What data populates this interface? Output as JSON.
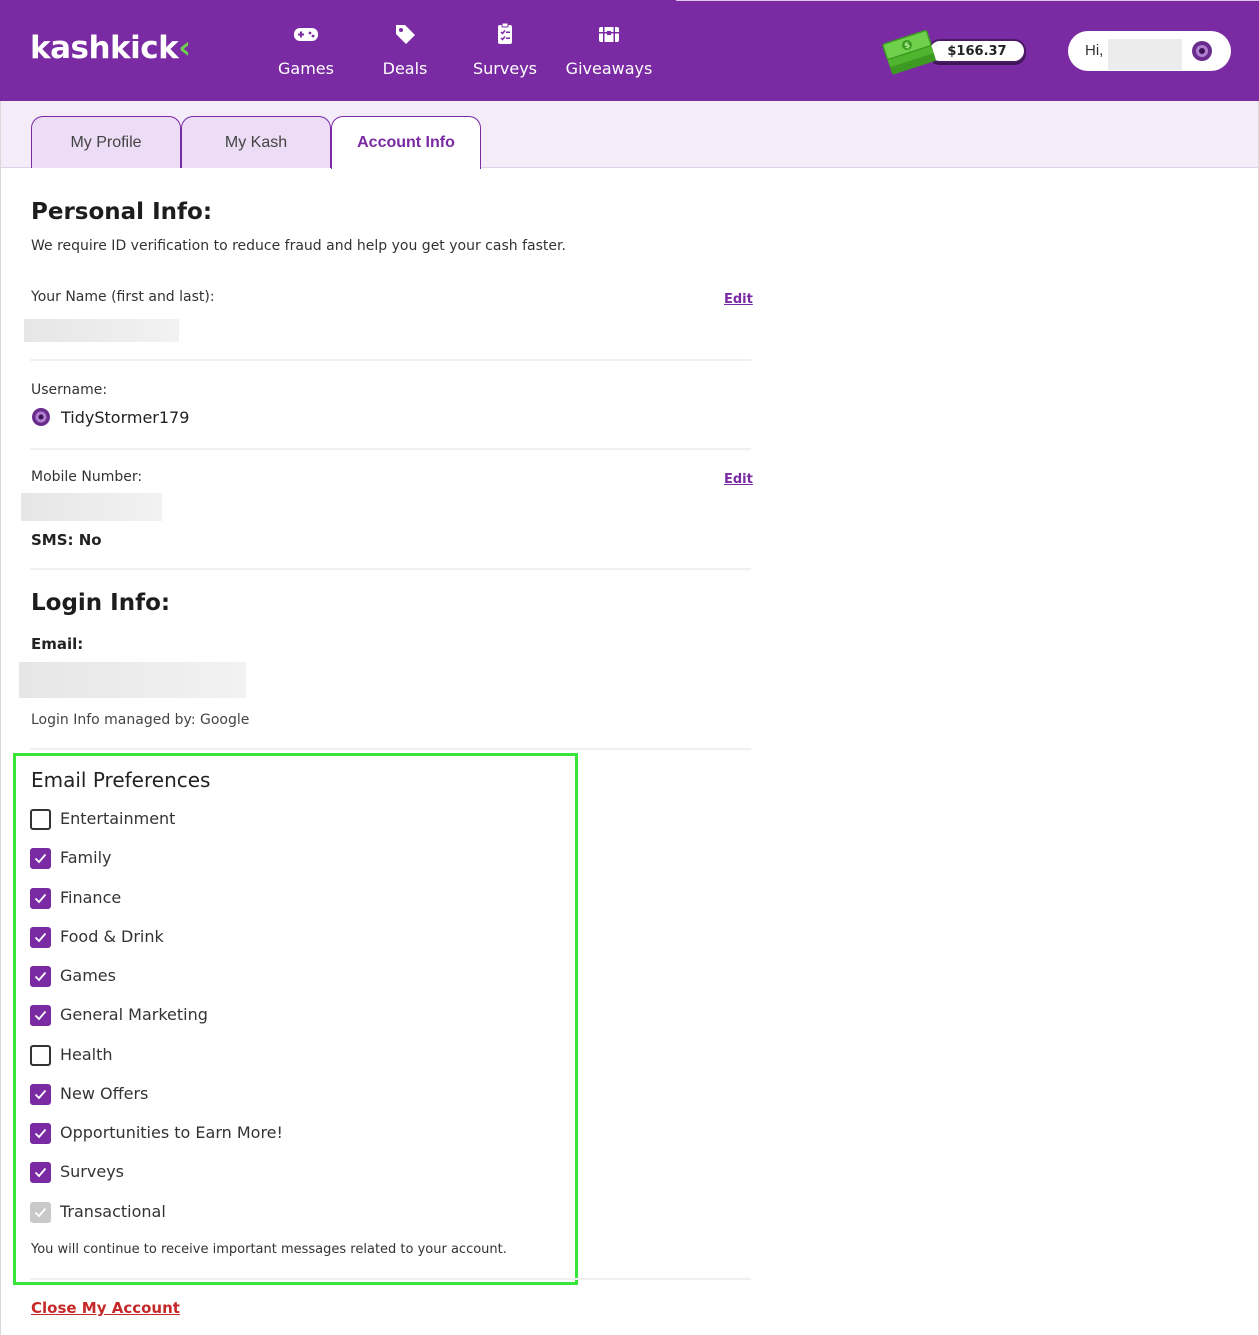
{
  "header": {
    "logo": "kashkick",
    "logo_mark": "‹",
    "nav": [
      {
        "label": "Games",
        "icon": "gamepad-icon"
      },
      {
        "label": "Deals",
        "icon": "tag-icon"
      },
      {
        "label": "Surveys",
        "icon": "clipboard-icon"
      },
      {
        "label": "Giveaways",
        "icon": "treasure-chest-icon"
      }
    ],
    "balance": "$166.37",
    "greeting": "Hi,"
  },
  "tabs": [
    {
      "label": "My Profile",
      "active": false
    },
    {
      "label": "My Kash",
      "active": false
    },
    {
      "label": "Account Info",
      "active": true
    }
  ],
  "personal": {
    "title": "Personal Info:",
    "subtitle": "We require ID verification to reduce fraud and help you get your cash faster.",
    "name_label": "Your Name (first and last):",
    "edit_label": "Edit",
    "username_label": "Username:",
    "username": "TidyStormer179",
    "mobile_label": "Mobile Number:",
    "sms": "SMS: No"
  },
  "login": {
    "title": "Login Info:",
    "email_label": "Email:",
    "managed_by": "Login Info managed by: Google"
  },
  "email_prefs": {
    "title": "Email Preferences",
    "items": [
      {
        "label": "Entertainment",
        "checked": false,
        "disabled": false
      },
      {
        "label": "Family",
        "checked": true,
        "disabled": false
      },
      {
        "label": "Finance",
        "checked": true,
        "disabled": false
      },
      {
        "label": "Food & Drink",
        "checked": true,
        "disabled": false
      },
      {
        "label": "Games",
        "checked": true,
        "disabled": false
      },
      {
        "label": "General Marketing",
        "checked": true,
        "disabled": false
      },
      {
        "label": "Health",
        "checked": false,
        "disabled": false
      },
      {
        "label": "New Offers",
        "checked": true,
        "disabled": false
      },
      {
        "label": "Opportunities to Earn More!",
        "checked": true,
        "disabled": false
      },
      {
        "label": "Surveys",
        "checked": true,
        "disabled": false
      },
      {
        "label": "Transactional",
        "checked": true,
        "disabled": true
      }
    ],
    "note": "You will continue to receive important messages related to your account."
  },
  "close_account": "Close My Account",
  "colors": {
    "brand": "#7a2aa3",
    "highlight": "#3ae53a",
    "danger": "#c62828",
    "money_green": "#6fd14b"
  }
}
